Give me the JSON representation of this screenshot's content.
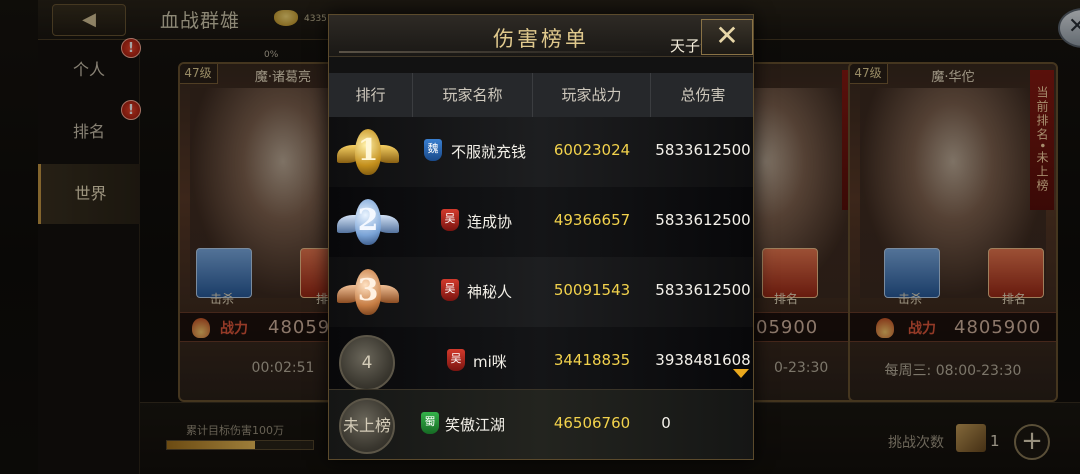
{
  "header": {
    "title": "血战群雄",
    "gold_value": "4335",
    "progress_pct": "0%"
  },
  "sidebar": {
    "items": [
      {
        "label": "个人",
        "badge": "!"
      },
      {
        "label": "排名",
        "badge": "!"
      },
      {
        "label": "世界",
        "badge": ""
      }
    ],
    "active_index": 2
  },
  "cards": [
    {
      "level": "47级",
      "name": "魔·诸葛亮",
      "kill_label": "击杀",
      "rank_label": "排名",
      "power_label": "战力",
      "power": "48059",
      "time": "00:02:51"
    },
    {
      "level": "",
      "name": "",
      "kill_label": "",
      "rank_label": "排名",
      "power_label": "",
      "power": "05900",
      "time": "0-23:30",
      "ribbon": "当前排名•未上榜"
    },
    {
      "level": "47级",
      "name": "魔·华佗",
      "kill_label": "击杀",
      "rank_label": "排名",
      "power_label": "战力",
      "power": "4805900",
      "time": "每周三:  08:00-23:30",
      "ribbon": "当前排名•未上榜"
    }
  ],
  "footer": {
    "progress_label": "累计目标伤害100万",
    "progress_fraction": 0.6,
    "challenge_label": "挑战次数",
    "challenge_count": "1",
    "add_label": "+"
  },
  "modal": {
    "title": "伤害榜单",
    "subtitle": "天子元",
    "close": "✕",
    "columns": [
      "排行",
      "玩家名称",
      "玩家战力",
      "总伤害"
    ],
    "rows": [
      {
        "rank": "1",
        "medal": "gold",
        "faction": "魏",
        "faction_class": "wei",
        "name": "不服就充钱",
        "power": "60023024",
        "damage": "5833612500"
      },
      {
        "rank": "2",
        "medal": "silver",
        "faction": "吴",
        "faction_class": "wu",
        "name": "连成协",
        "power": "49366657",
        "damage": "5833612500"
      },
      {
        "rank": "3",
        "medal": "bronze",
        "faction": "吴",
        "faction_class": "wu",
        "name": "神秘人",
        "power": "50091543",
        "damage": "5833612500"
      },
      {
        "rank": "4",
        "medal": "coin",
        "faction": "吴",
        "faction_class": "wu",
        "name": "mi咪",
        "power": "34418835",
        "damage": "3938481608"
      }
    ],
    "mine": {
      "rank": "未上榜",
      "faction": "蜀",
      "faction_class": "shu",
      "name": "笑傲江湖",
      "power": "46506760",
      "damage": "0"
    }
  }
}
